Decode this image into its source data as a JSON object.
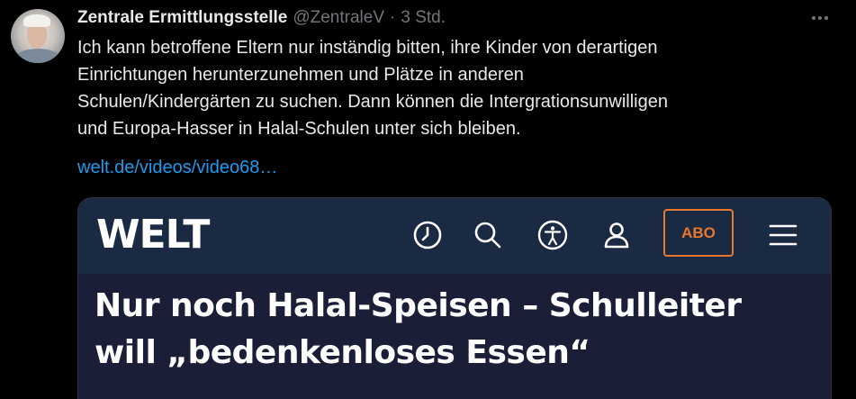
{
  "tweet": {
    "author_name": "Zentrale Ermittlungsstelle",
    "author_handle": "@ZentraleV",
    "separator": "·",
    "time": "3 Std.",
    "text_lines": [
      "Ich kann betroffene Eltern nur inständig bitten, ihre Kinder von derartigen",
      "Einrichtungen herunterzunehmen und Plätze in anderen",
      "Schulen/Kindergärten zu suchen. Dann können die Intergrationsunwilligen",
      "und Europa-Hasser in Halal-Schulen unter sich bleiben."
    ],
    "link_text": "welt.de/videos/video68…",
    "more_icon": "more-horizontal-icon"
  },
  "card": {
    "logo": "WELT",
    "nav_icons": [
      "clock-icon",
      "search-icon",
      "accessibility-icon",
      "user-icon",
      "menu-icon"
    ],
    "abo_label": "ABO",
    "headline_lines": [
      "Nur noch Halal-Speisen – Schulleiter",
      "will „bedenkenloses Essen“"
    ],
    "colors": {
      "bar": "#1b2a43",
      "body": "#1a1f37",
      "abo": "#e8772e"
    }
  },
  "colors": {
    "background": "#000000",
    "text": "#e7e9ea",
    "muted": "#71767b",
    "link": "#1d9bf0"
  }
}
